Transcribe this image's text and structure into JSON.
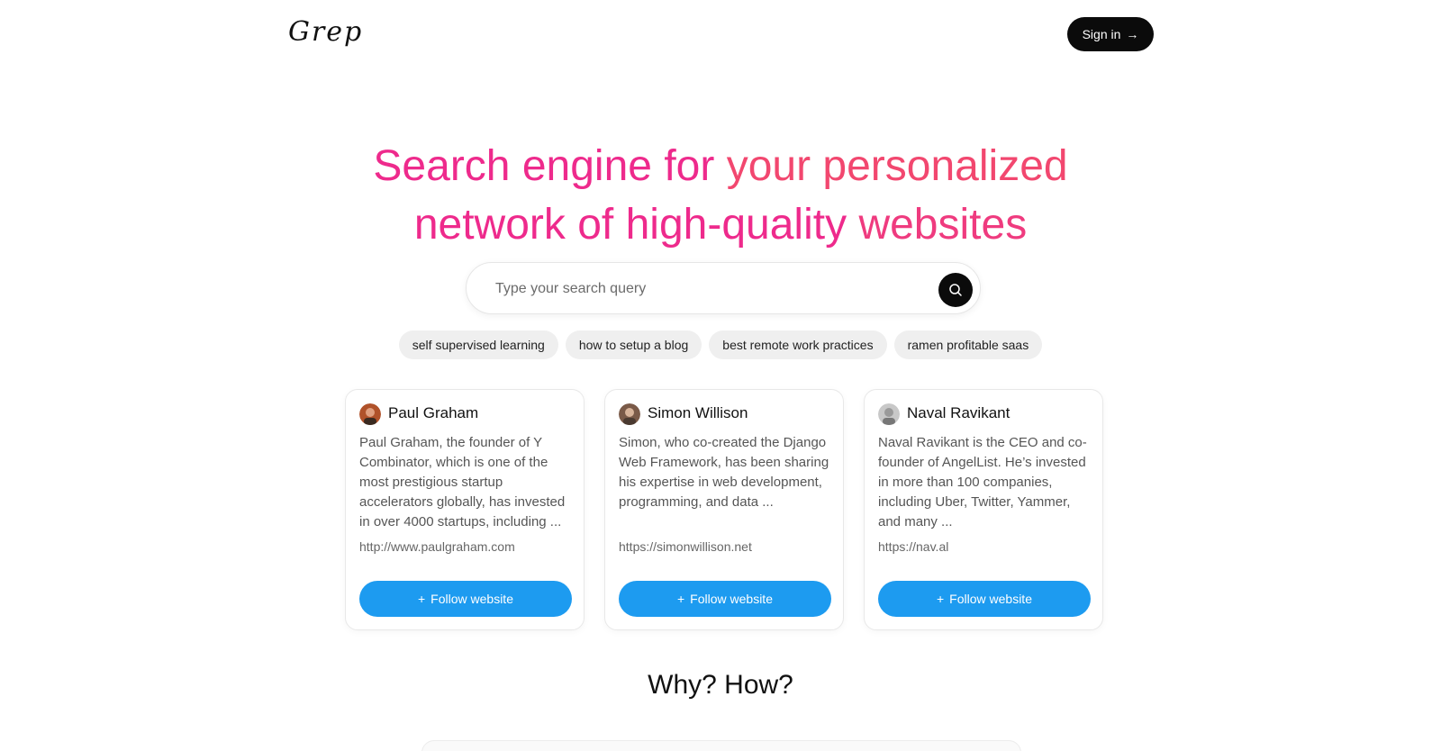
{
  "header": {
    "logo": "Grep",
    "signin_label": "Sign in",
    "signin_icon": "arrow-right-icon"
  },
  "hero": {
    "line1": [
      "Search",
      "engine",
      "for",
      "your",
      "personalized"
    ],
    "line2": [
      "network",
      "of",
      "high-quality",
      "websites"
    ]
  },
  "search": {
    "placeholder": "Type your search query",
    "button_icon": "search-icon"
  },
  "suggestions": [
    "self supervised learning",
    "how to setup a blog",
    "best remote work practices",
    "ramen profitable saas"
  ],
  "cards": [
    {
      "name": "Paul Graham",
      "description": "Paul Graham, the founder of Y Combinator, which is one of the most prestigious startup accelerators globally, has invested in over 4000 startups, including ...",
      "url": "http://www.paulgraham.com",
      "follow_label": "Follow website",
      "avatar_color": "#b0522a"
    },
    {
      "name": "Simon Willison",
      "description": "Simon, who co-created the Django Web Framework, has been sharing his expertise in web development, programming, and data ...",
      "url": "https://simonwillison.net",
      "follow_label": "Follow website",
      "avatar_color": "#7a5a48"
    },
    {
      "name": "Naval Ravikant",
      "description": "Naval Ravikant is the CEO and co-founder of AngelList. He’s invested in more than 100 companies, including Uber, Twitter, Yammer, and many ...",
      "url": "https://nav.al",
      "follow_label": "Follow website",
      "avatar_color": "#9a9a9a"
    }
  ],
  "why_title": "Why? How?",
  "colors": {
    "accent_blue": "#1d9bf0",
    "hero_pink": "#ee2a8c",
    "hero_coral": "#f2476f",
    "dark": "#0b0b0b"
  }
}
